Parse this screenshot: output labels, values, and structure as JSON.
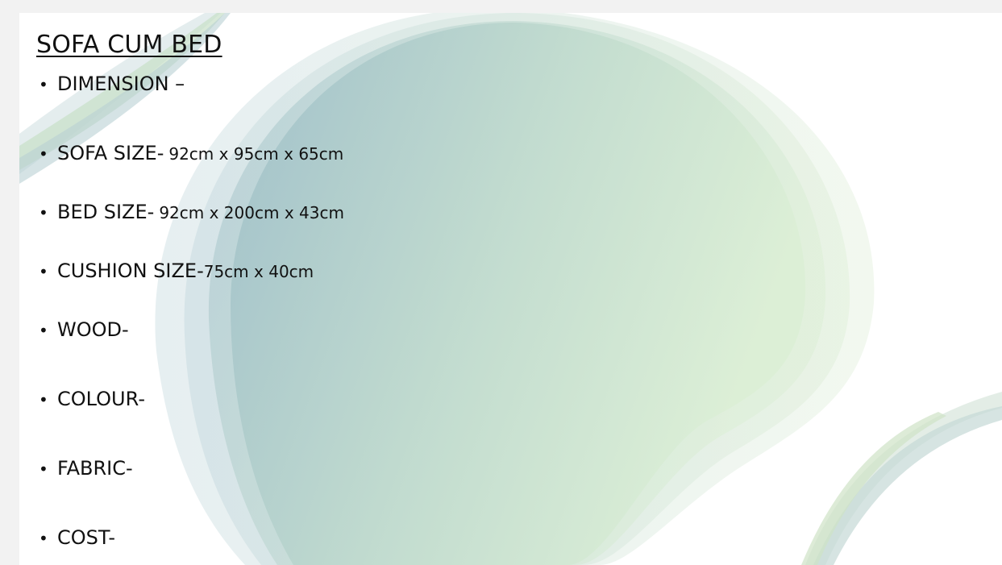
{
  "slide": {
    "title": "SOFA CUM BED",
    "bullet_char": "•",
    "items": [
      {
        "label": "DIMENSION –",
        "value": ""
      },
      {
        "label": "SOFA SIZE-",
        "value": "92cm x 95cm x 65cm"
      },
      {
        "label": "BED SIZE-",
        "value": "92cm x 200cm x 43cm"
      },
      {
        "label": "CUSHION SIZE-",
        "value": "75cm x 40cm"
      },
      {
        "label": "WOOD-",
        "value": ""
      },
      {
        "label": "COLOUR-",
        "value": ""
      },
      {
        "label": "FABRIC-",
        "value": ""
      },
      {
        "label": "COST-",
        "value": ""
      }
    ]
  },
  "colors": {
    "blob_blue": "#9dbfc8",
    "blob_green": "#d6ead0",
    "text": "#111111"
  }
}
